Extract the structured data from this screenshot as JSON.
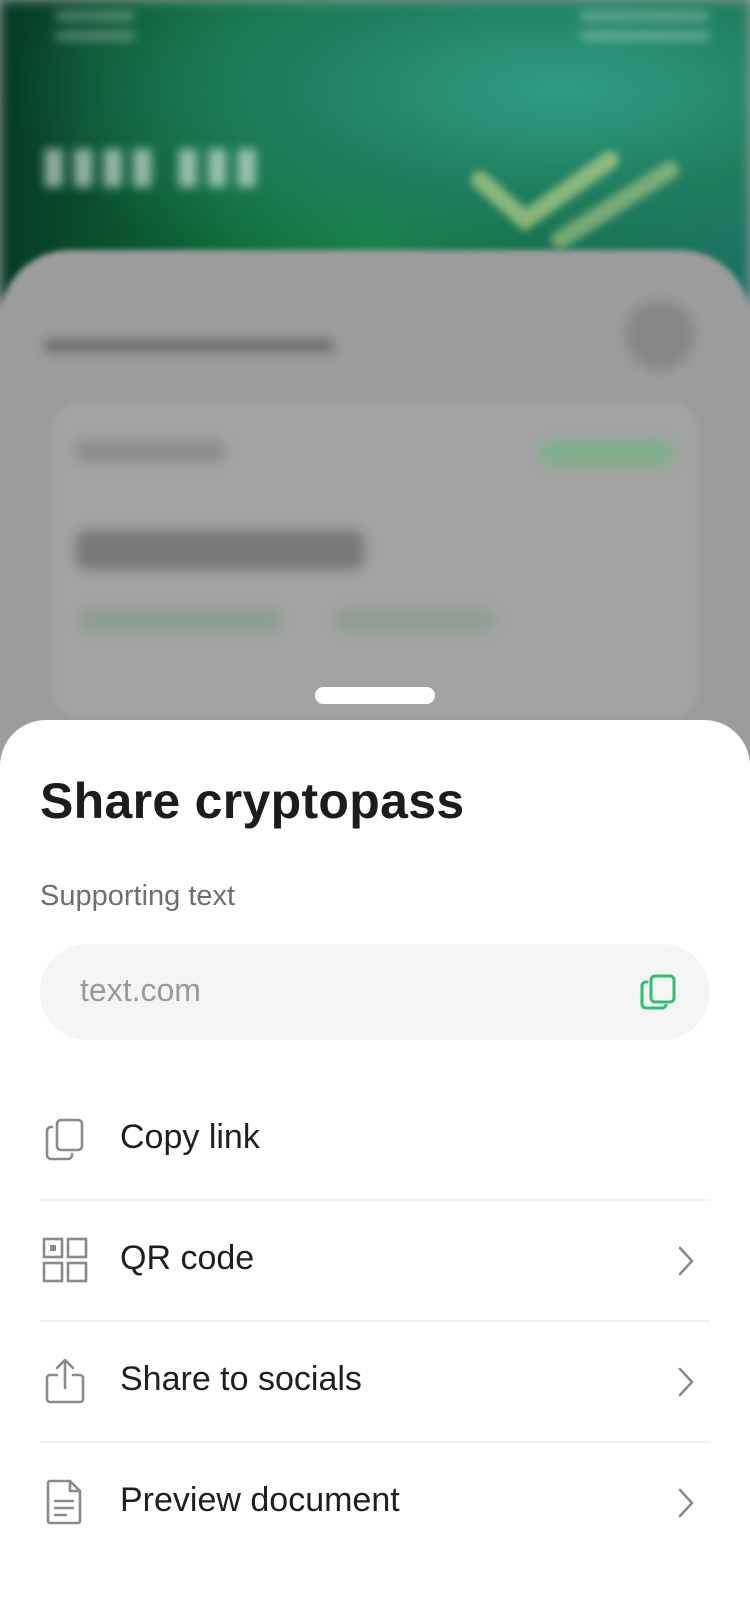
{
  "colors": {
    "accent": "#2fbf71",
    "sheet_background": "#ffffff",
    "field_background": "#f4f4f4",
    "icon_gray": "#8a8a8a"
  },
  "sheet": {
    "title": "Share cryptopass",
    "supporting_text": "Supporting text",
    "link_field": {
      "value": "text.com",
      "copy_icon": "copy-icon"
    },
    "menu": [
      {
        "label": "Copy link",
        "icon": "copy-icon",
        "has_chevron": false
      },
      {
        "label": "QR code",
        "icon": "qr-code-icon",
        "has_chevron": true
      },
      {
        "label": "Share to socials",
        "icon": "share-icon",
        "has_chevron": true
      },
      {
        "label": "Preview document",
        "icon": "document-icon",
        "has_chevron": true
      }
    ]
  }
}
